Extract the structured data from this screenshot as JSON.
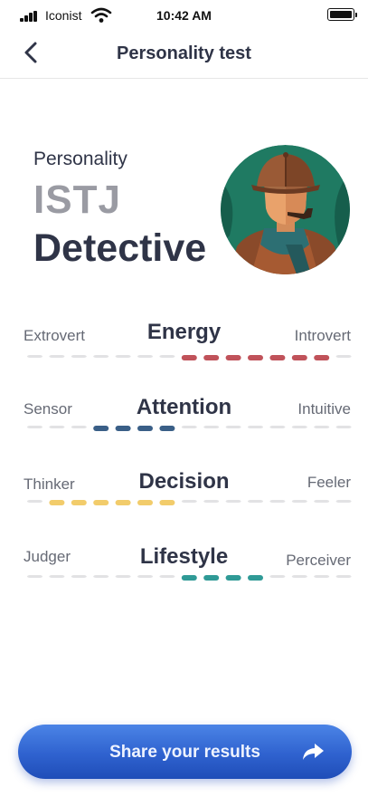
{
  "status_bar": {
    "carrier": "Iconist",
    "time": "10:42 AM"
  },
  "nav": {
    "title": "Personality test",
    "back_icon": "chevron-left-icon"
  },
  "personality": {
    "label": "Personality",
    "code": "ISTJ",
    "name": "Detective",
    "avatar_icon": "detective-avatar"
  },
  "traits": [
    {
      "name": "Energy",
      "left": "Extrovert",
      "right": "Introvert",
      "active_from": 7,
      "active_to": 14,
      "color": "#c0525a"
    },
    {
      "name": "Attention",
      "left": "Sensor",
      "right": "Intuitive",
      "active_from": 3,
      "active_to": 7,
      "color": "#3a5f87"
    },
    {
      "name": "Decision",
      "left": "Thinker",
      "right": "Feeler",
      "active_from": 1,
      "active_to": 7,
      "color": "#f2cc6b"
    },
    {
      "name": "Lifestyle",
      "left": "Judger",
      "right": "Perceiver",
      "active_from": 7,
      "active_to": 11,
      "color": "#2f9a96"
    }
  ],
  "scale": {
    "segment_count": 15,
    "inactive_color": "#e2e2e4"
  },
  "share_button": {
    "label": "Share your results",
    "icon": "share-arrow-icon"
  },
  "colors": {
    "primary": "#2f62cf",
    "text_dark": "#2f3447",
    "text_muted": "#9a9ba3"
  }
}
